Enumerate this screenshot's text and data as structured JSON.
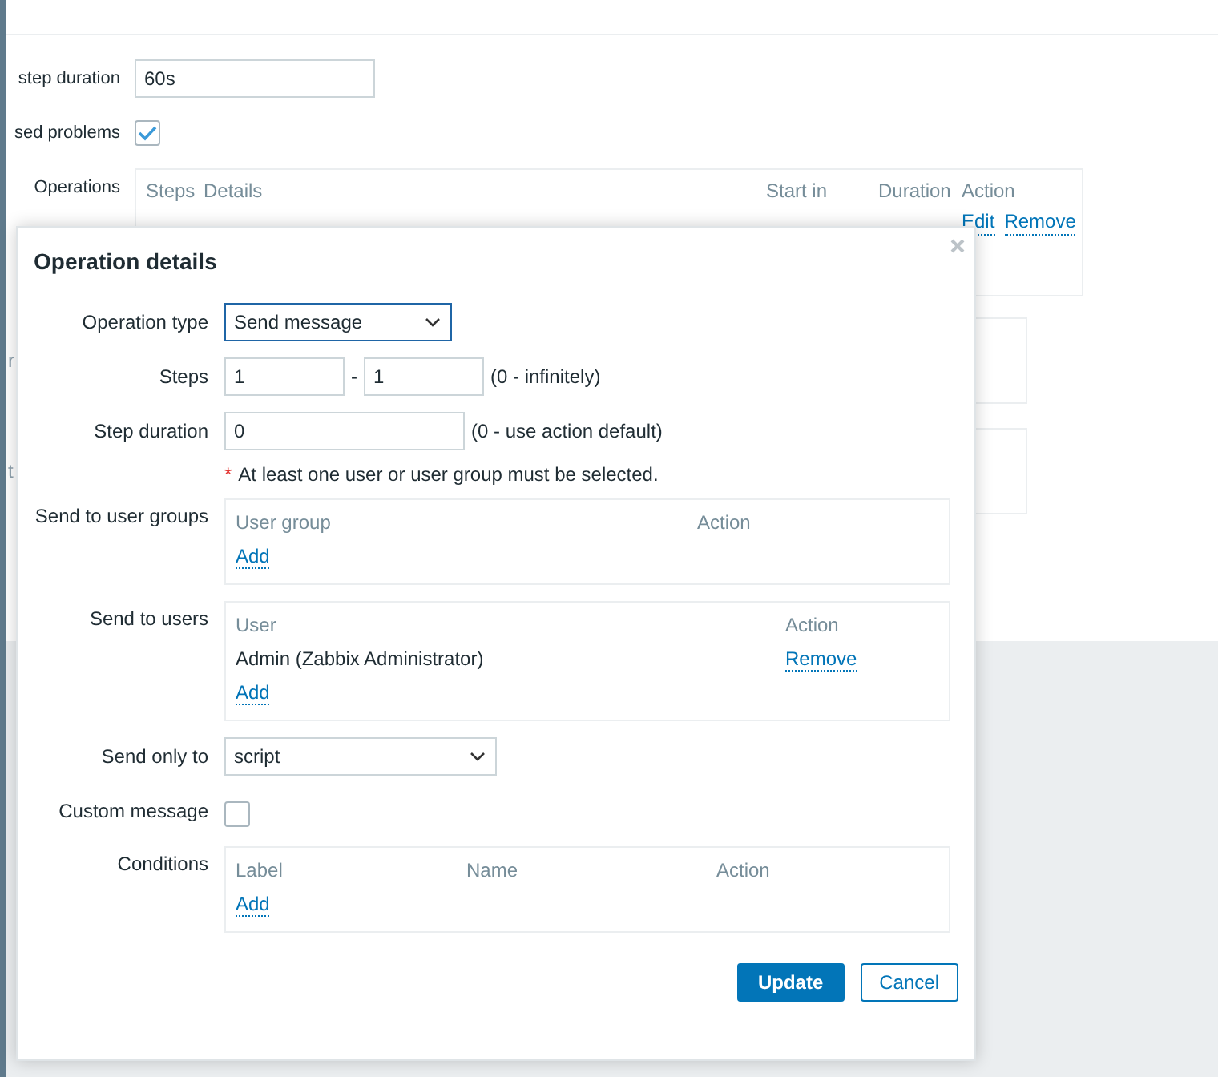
{
  "page": {
    "fields": [
      {
        "kind": "text",
        "label": "step duration",
        "value": "60s"
      },
      {
        "kind": "checkbox",
        "label": "sed problems",
        "checked": true
      }
    ],
    "operations": {
      "label": "Operations",
      "columns": [
        "Steps",
        "Details",
        "Start in",
        "Duration",
        "Action"
      ],
      "rows": [
        {
          "actions": [
            "Edit",
            "Remove"
          ]
        }
      ]
    },
    "fragments": [
      "r",
      "t"
    ]
  },
  "dialog": {
    "title": "Operation details",
    "rows": [
      {
        "kind": "select",
        "label": "Operation type",
        "value": "Send message",
        "focused": true
      },
      {
        "kind": "range",
        "label": "Steps",
        "from": "1",
        "separator": "-",
        "to": "1",
        "hint": "(0 - infinitely)"
      },
      {
        "kind": "text",
        "label": "Step duration",
        "value": "0",
        "hint": "(0 - use action default)"
      },
      {
        "kind": "note",
        "mark": "*",
        "text": "At least one user or user group must be selected."
      },
      {
        "kind": "table",
        "label": "Send to user groups",
        "columns": [
          "User group",
          "Action"
        ],
        "add": "Add"
      },
      {
        "kind": "table",
        "label": "Send to users",
        "columns": [
          "User",
          "Action"
        ],
        "rows": [
          {
            "name": "Admin (Zabbix Administrator)",
            "action": "Remove"
          }
        ],
        "add": "Add"
      },
      {
        "kind": "select",
        "label": "Send only to",
        "value": "script",
        "focused": false
      },
      {
        "kind": "checkbox",
        "label": "Custom message",
        "checked": false
      },
      {
        "kind": "table",
        "label": "Conditions",
        "columns": [
          "Label",
          "Name",
          "Action"
        ],
        "add": "Add"
      }
    ],
    "buttons": [
      {
        "label": "Update",
        "primary": true
      },
      {
        "label": "Cancel",
        "primary": false
      }
    ]
  }
}
